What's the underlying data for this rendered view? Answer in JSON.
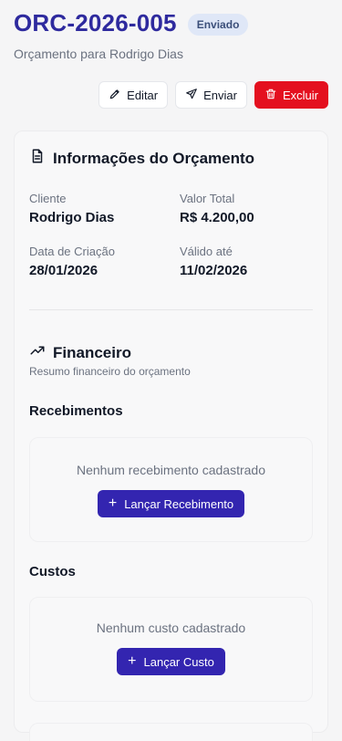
{
  "header": {
    "title": "ORC-2026-005",
    "status": "Enviado",
    "subtitle": "Orçamento para Rodrigo Dias"
  },
  "actions": {
    "edit": "Editar",
    "send": "Enviar",
    "delete": "Excluir"
  },
  "info": {
    "title": "Informações do Orçamento",
    "fields": [
      {
        "label": "Cliente",
        "value": "Rodrigo Dias"
      },
      {
        "label": "Valor Total",
        "value": "R$ 4.200,00"
      },
      {
        "label": "Data de Criação",
        "value": "28/01/2026"
      },
      {
        "label": "Válido até",
        "value": "11/02/2026"
      }
    ]
  },
  "financial": {
    "title": "Financeiro",
    "description": "Resumo financeiro do orçamento",
    "receipts": {
      "title": "Recebimentos",
      "empty": "Nenhum recebimento cadastrado",
      "button": "Lançar Recebimento"
    },
    "costs": {
      "title": "Custos",
      "empty": "Nenhum custo cadastrado",
      "button": "Lançar Custo"
    }
  },
  "colors": {
    "brand": "#2e2a9e",
    "primary_button": "#3325b0",
    "danger": "#e4101f",
    "badge_bg": "#dfe7f7"
  }
}
